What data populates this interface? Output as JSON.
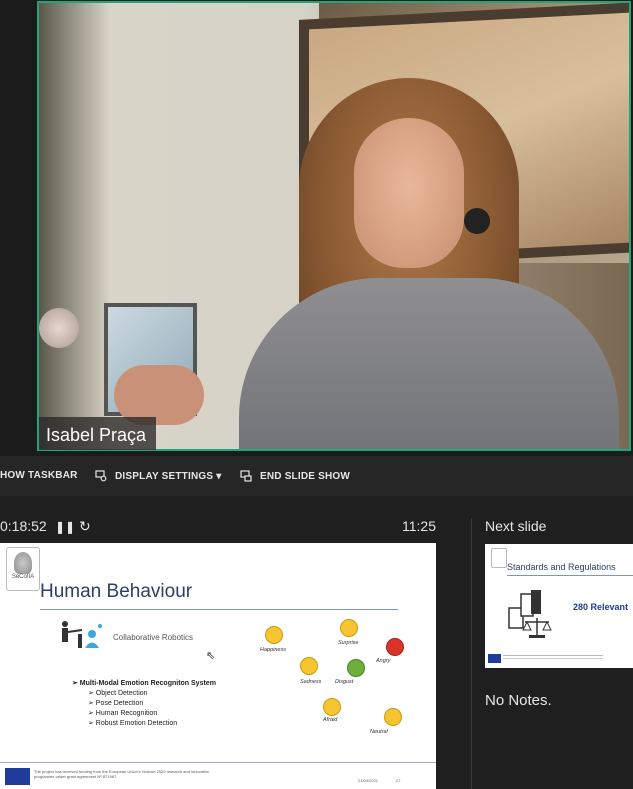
{
  "video": {
    "participant_name": "Isabel Praça"
  },
  "toolbar": {
    "show_taskbar": "HOW TASKBAR",
    "display_settings": "DISPLAY SETTINGS ▾",
    "end_slide_show": "END SLIDE SHOW"
  },
  "presenter": {
    "timer": "0:18:52",
    "pause_icon": "pause-icon",
    "reset_icon": "reset-icon",
    "clock": "11:25",
    "next_slide_label": "Next slide",
    "notes": "No Notes."
  },
  "current_slide": {
    "logo_text": "SeCoIIA",
    "title": "Human Behaviour",
    "collab": "Collaborative Robotics",
    "mm_title": "➢ Multi-Modal Emotion Recogniton System",
    "items": [
      "➢ Object Detection",
      "➢ Pose Detection",
      "➢ Human Recognition",
      "➢ Robust Emotion Detection"
    ],
    "emotions": {
      "happiness": "Happiness",
      "surprise": "Surprise",
      "angry": "Angry",
      "sadness": "Sadness",
      "disgust": "Disgust",
      "afraid": "Afraid",
      "neutral": "Neutral"
    },
    "emotion_colors": {
      "neutral": "#f7c531",
      "angry": "#d8352a",
      "disgust": "#6fae3a"
    },
    "footer": "The project has received funding from the European Union's Horizon 2020 research and innovation programme under grant agreement Nº 871967.",
    "date": "21/04/2021",
    "page": "27"
  },
  "next_slide": {
    "title": "Standards and Regulations",
    "relevant": "280 Relevant"
  },
  "colors": {
    "active_speaker_border": "#21a67a",
    "slide_title": "#2c3e6a"
  }
}
